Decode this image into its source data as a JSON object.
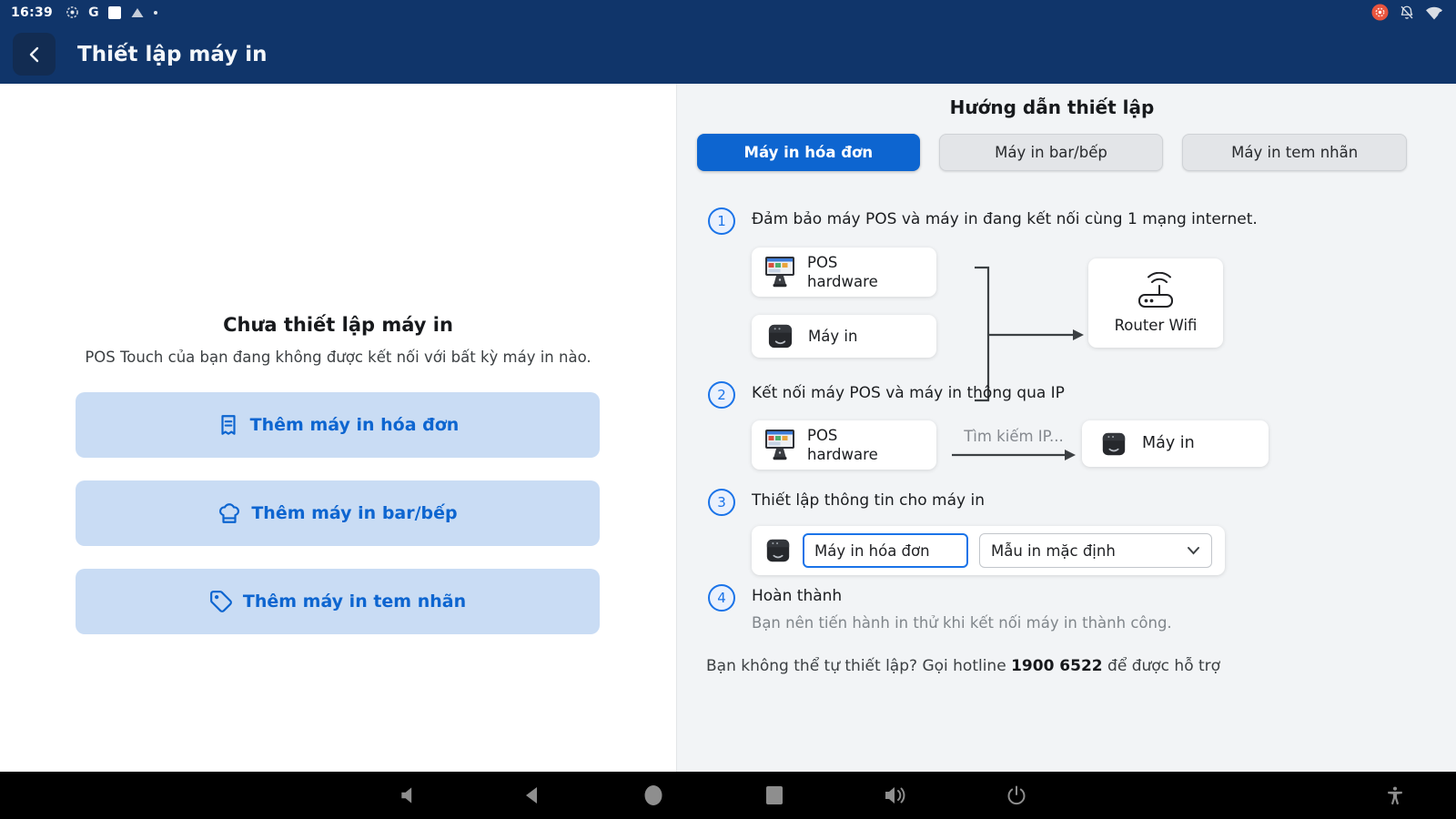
{
  "status_bar": {
    "time": "16:39",
    "google_letter": "G",
    "left_icons": [
      "screen-record",
      "google",
      "white-square",
      "upload-triangle",
      "dot"
    ],
    "right_icons": [
      "recording-badge",
      "notifications-off",
      "wifi"
    ]
  },
  "header": {
    "title": "Thiết lập máy in"
  },
  "left_panel": {
    "title": "Chưa thiết lập máy in",
    "subtitle": "POS Touch của bạn đang không được kết nối với bất kỳ máy in nào.",
    "buttons": [
      {
        "label": "Thêm máy in hóa đơn",
        "icon": "receipt-icon"
      },
      {
        "label": "Thêm máy in bar/bếp",
        "icon": "chef-hat-icon"
      },
      {
        "label": "Thêm máy in tem nhãn",
        "icon": "tag-icon"
      }
    ]
  },
  "guide": {
    "title": "Hướng dẫn thiết lập",
    "tabs": [
      {
        "label": "Máy in hóa đơn",
        "active": true
      },
      {
        "label": "Máy in bar/bếp",
        "active": false
      },
      {
        "label": "Máy in tem nhãn",
        "active": false
      }
    ],
    "steps": [
      {
        "number": "1",
        "text": "Đảm bảo máy POS và máy in đang kết nối cùng 1 mạng internet."
      },
      {
        "number": "2",
        "text": "Kết nối máy POS và máy in thông qua IP"
      },
      {
        "number": "3",
        "text": "Thiết lập thông tin cho máy in"
      },
      {
        "number": "4",
        "text": "Hoàn thành",
        "subtext": "Bạn nên tiến hành in thử khi kết nối máy in thành công."
      }
    ],
    "diagram1": {
      "pos_label": "POS hardware",
      "printer_label": "Máy in",
      "router_label": "Router Wifi"
    },
    "diagram2": {
      "pos_label": "POS hardware",
      "arrow_label": "Tìm kiếm IP...",
      "printer_label": "Máy in"
    },
    "form": {
      "printer_name_value": "Máy in hóa đơn",
      "template_value": "Mẫu in mặc định"
    },
    "hotline": {
      "prefix": "Bạn không thể tự thiết lập? Gọi hotline ",
      "number": "1900 6522",
      "suffix": " để được hỗ trợ"
    }
  },
  "nav_bar": {
    "icons": [
      "volume-down",
      "back",
      "home",
      "recents",
      "volume-up",
      "power",
      "accessibility"
    ]
  },
  "colors": {
    "header_bg": "#10356a",
    "accent_blue": "#0d65d0",
    "step_blue": "#1a73e8",
    "light_blue_button": "#c9dcf4",
    "right_panel_bg": "#f2f4f6",
    "inactive_tab": "#e3e5e8",
    "recording_badge": "#e8543e",
    "nav_icon_gray": "#8e8e8e"
  }
}
